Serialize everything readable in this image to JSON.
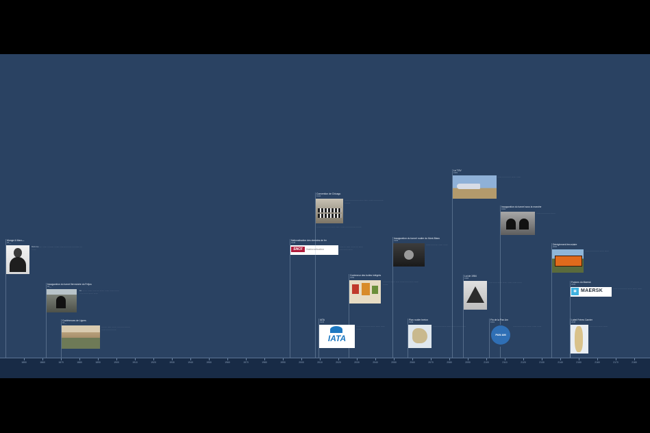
{
  "axis": {
    "years": [
      "1850",
      "1860",
      "1870",
      "1880",
      "1890",
      "1900",
      "1910",
      "1920",
      "1930",
      "1940",
      "1950",
      "1960",
      "1970",
      "1980",
      "1990",
      "2000",
      "2010",
      "2020",
      "2030",
      "2040",
      "2050",
      "2060",
      "2070",
      "2080",
      "2090",
      "2100",
      "2110",
      "2120",
      "2130",
      "2140",
      "2150",
      "2160",
      "2170",
      "2180",
      "2190",
      "2200",
      "2210"
    ]
  },
  "cards": [
    {
      "title": "Monge & Marx—",
      "date": "18__",
      "desc": "Réforme …. ……. ………. …….. ………………. ……….. …. ……."
    },
    {
      "title": "Inauguration du tunnel ferroviaire du Fréjus",
      "date": "18__",
      "desc": "Le …. … ……. …… …. ……. ……. ……. ……. …… ……. ……. ……."
    },
    {
      "title": "Conférences de Lignes",
      "date": "18__",
      "desc": "…. …. …… …. … …. ……. …….. ……. ……. …….."
    },
    {
      "title": "Nationalisation des chemins de fer",
      "date": "1938",
      "desc": "……. … …… ……. …. ……. …… ……. ……."
    },
    {
      "title": "Convention de Chicago",
      "date": "1944",
      "desc": "……. ……. ……. ……. …… ……. ……. …….. ………"
    },
    {
      "title": "Conteneur des boites intégrés",
      "date": "1956",
      "desc": "…. ……. ……. …… ……. …… ……. ……. …….."
    },
    {
      "title": "IATA",
      "date": "1945",
      "desc": "……. ……. ……. ……. ……. ……. …….."
    },
    {
      "title": "Inauguration du tunnel routier du Mont-Blanc",
      "date": "1965",
      "desc": "……. …… …. ……. ……."
    },
    {
      "title": "Plan routier breton",
      "date": "1969",
      "desc": "…… ……. ……. …… ……. ……. ……."
    },
    {
      "title": "Le TGV",
      "date": "1981",
      "desc": "……. ……. …… ……. ……."
    },
    {
      "title": "Loi de 1984",
      "date": "1984",
      "desc": "…… ……. ……. ……. ……. ……. ……."
    },
    {
      "title": "Inauguration du tunnel sous la manche",
      "date": "1994",
      "desc": "……. ……. ……. ……."
    },
    {
      "title": "Fin de la Pan Am",
      "date": "1991",
      "desc": "…… ……. ……. ……. ……. ……."
    },
    {
      "title": "Dérèglement ferroviaire",
      "date": "2000",
      "desc": "……. ……. ……. ……. ……."
    },
    {
      "title": "Fusions du Maersk",
      "date": "2005",
      "desc": "……. ……. ……. ……. ……. ……."
    },
    {
      "title": "Label Fréres Camier",
      "date": "2008",
      "desc": "…… ……. ……. ……."
    }
  ],
  "thumbs": {
    "sncf_logo": "SNCF",
    "iata_logo": "IATA",
    "panam_logo": "PAN AM",
    "maersk_logo": "MAERSK",
    "maersk_star": "✶"
  }
}
